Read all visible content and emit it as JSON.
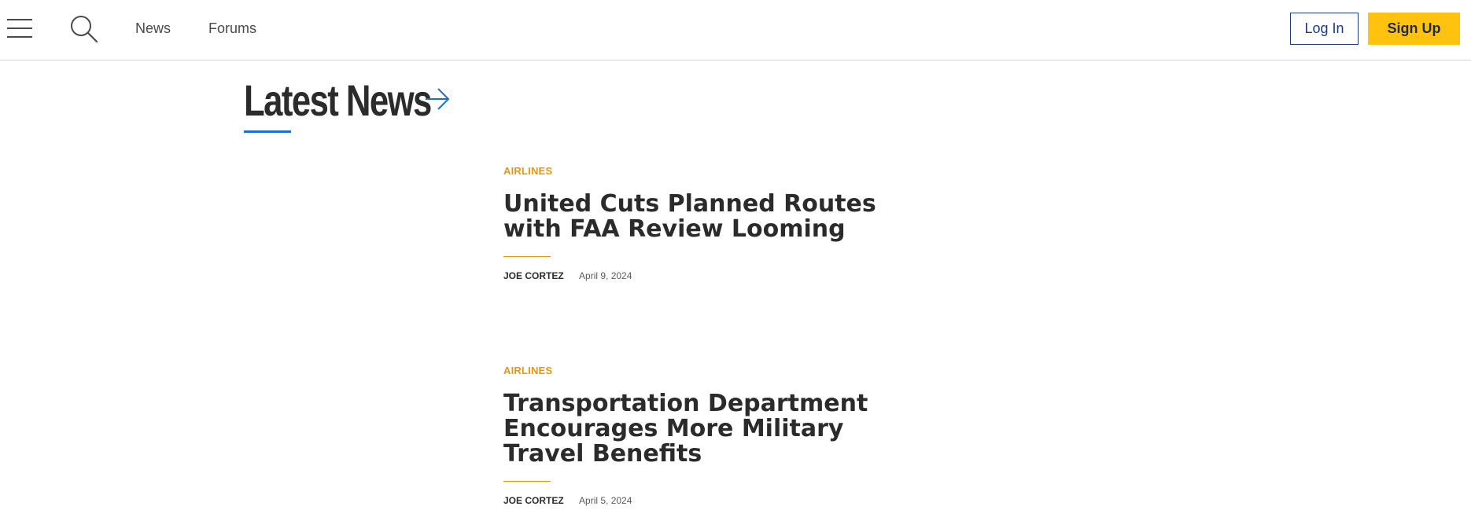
{
  "header": {
    "nav": [
      {
        "label": "News"
      },
      {
        "label": "Forums"
      }
    ],
    "login_label": "Log In",
    "signup_label": "Sign Up",
    "accent_color": "#ffc20e",
    "login_color": "#1f3b7a"
  },
  "main": {
    "section_title": "Latest News",
    "section_accent_color": "#1a6fd1",
    "articles": [
      {
        "category": "AIRLINES",
        "headline": "United Cuts Planned Routes with FAA Review Looming",
        "author": "JOE CORTEZ",
        "date": "April 9, 2024"
      },
      {
        "category": "AIRLINES",
        "headline": "Transportation Department Encourages More Military Travel Benefits",
        "author": "JOE CORTEZ",
        "date": "April 5, 2024"
      }
    ],
    "category_color": "#e8950c"
  },
  "icons": {
    "menu": "menu-icon",
    "search": "search-icon",
    "arrow": "arrow-right-icon"
  }
}
